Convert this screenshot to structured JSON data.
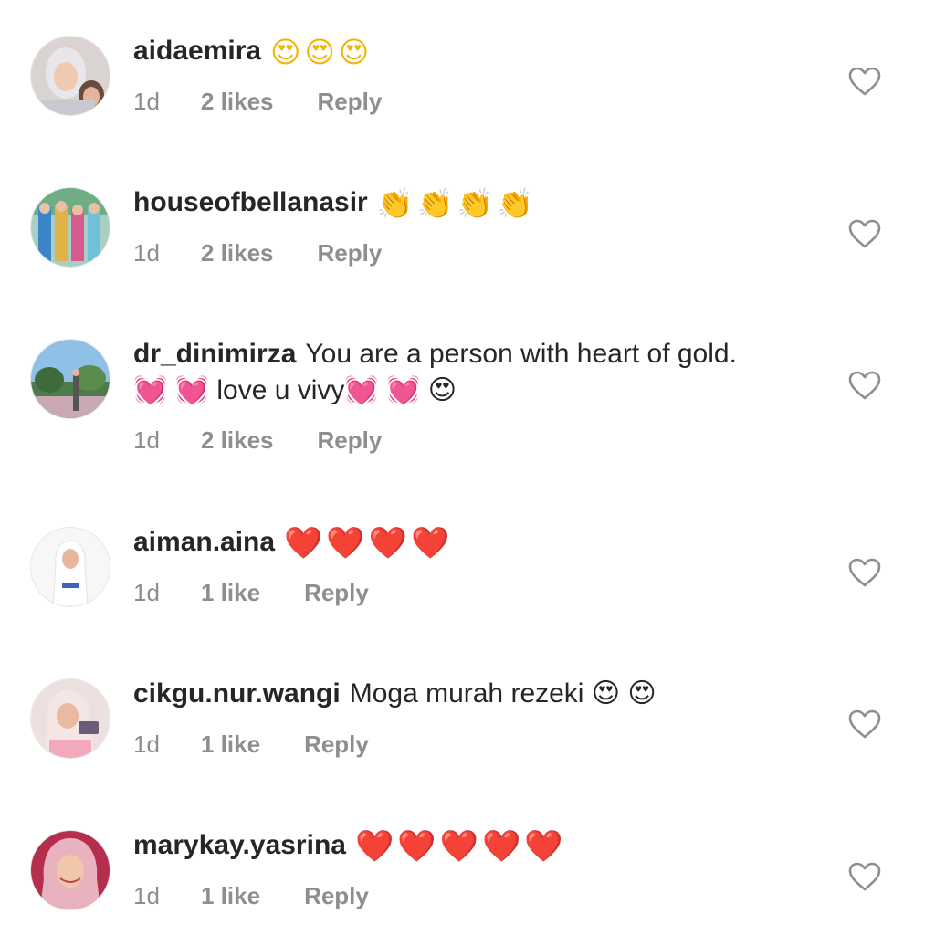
{
  "comments": [
    {
      "username": "aidaemira",
      "text": "",
      "emojis": "😍😍😍",
      "time": "1d",
      "likes": "2 likes",
      "reply": "Reply",
      "avatar_bg": "#dcd6d4"
    },
    {
      "username": "houseofbellanasir",
      "text": "",
      "emojis": "👏👏👏👏",
      "time": "1d",
      "likes": "2 likes",
      "reply": "Reply",
      "avatar_bg": "#9cc9c2"
    },
    {
      "username": "dr_dinimirza",
      "text": "You are a person with heart of gold. 💓 💓  love u vivy💓 💓 😍",
      "emojis": "",
      "time": "1d",
      "likes": "2 likes",
      "reply": "Reply",
      "avatar_bg": "#7fb2d6"
    },
    {
      "username": "aiman.aina",
      "text": "",
      "emojis": "❤️❤️❤️❤️",
      "time": "1d",
      "likes": "1 like",
      "reply": "Reply",
      "avatar_bg": "#f2f2f2"
    },
    {
      "username": "cikgu.nur.wangi",
      "text": "Moga murah rezeki 😍 😍",
      "emojis": "",
      "time": "1d",
      "likes": "1 like",
      "reply": "Reply",
      "avatar_bg": "#e9d9d8"
    },
    {
      "username": "marykay.yasrina",
      "text": "",
      "emojis": "❤️❤️❤️❤️❤️",
      "time": "1d",
      "likes": "1 like",
      "reply": "Reply",
      "avatar_bg": "#c7365a"
    }
  ],
  "colors": {
    "text": "#262626",
    "meta": "#8e8e8e",
    "heart_outline": "#8e8e8e"
  },
  "icons": {
    "like": "heart-outline-icon"
  }
}
